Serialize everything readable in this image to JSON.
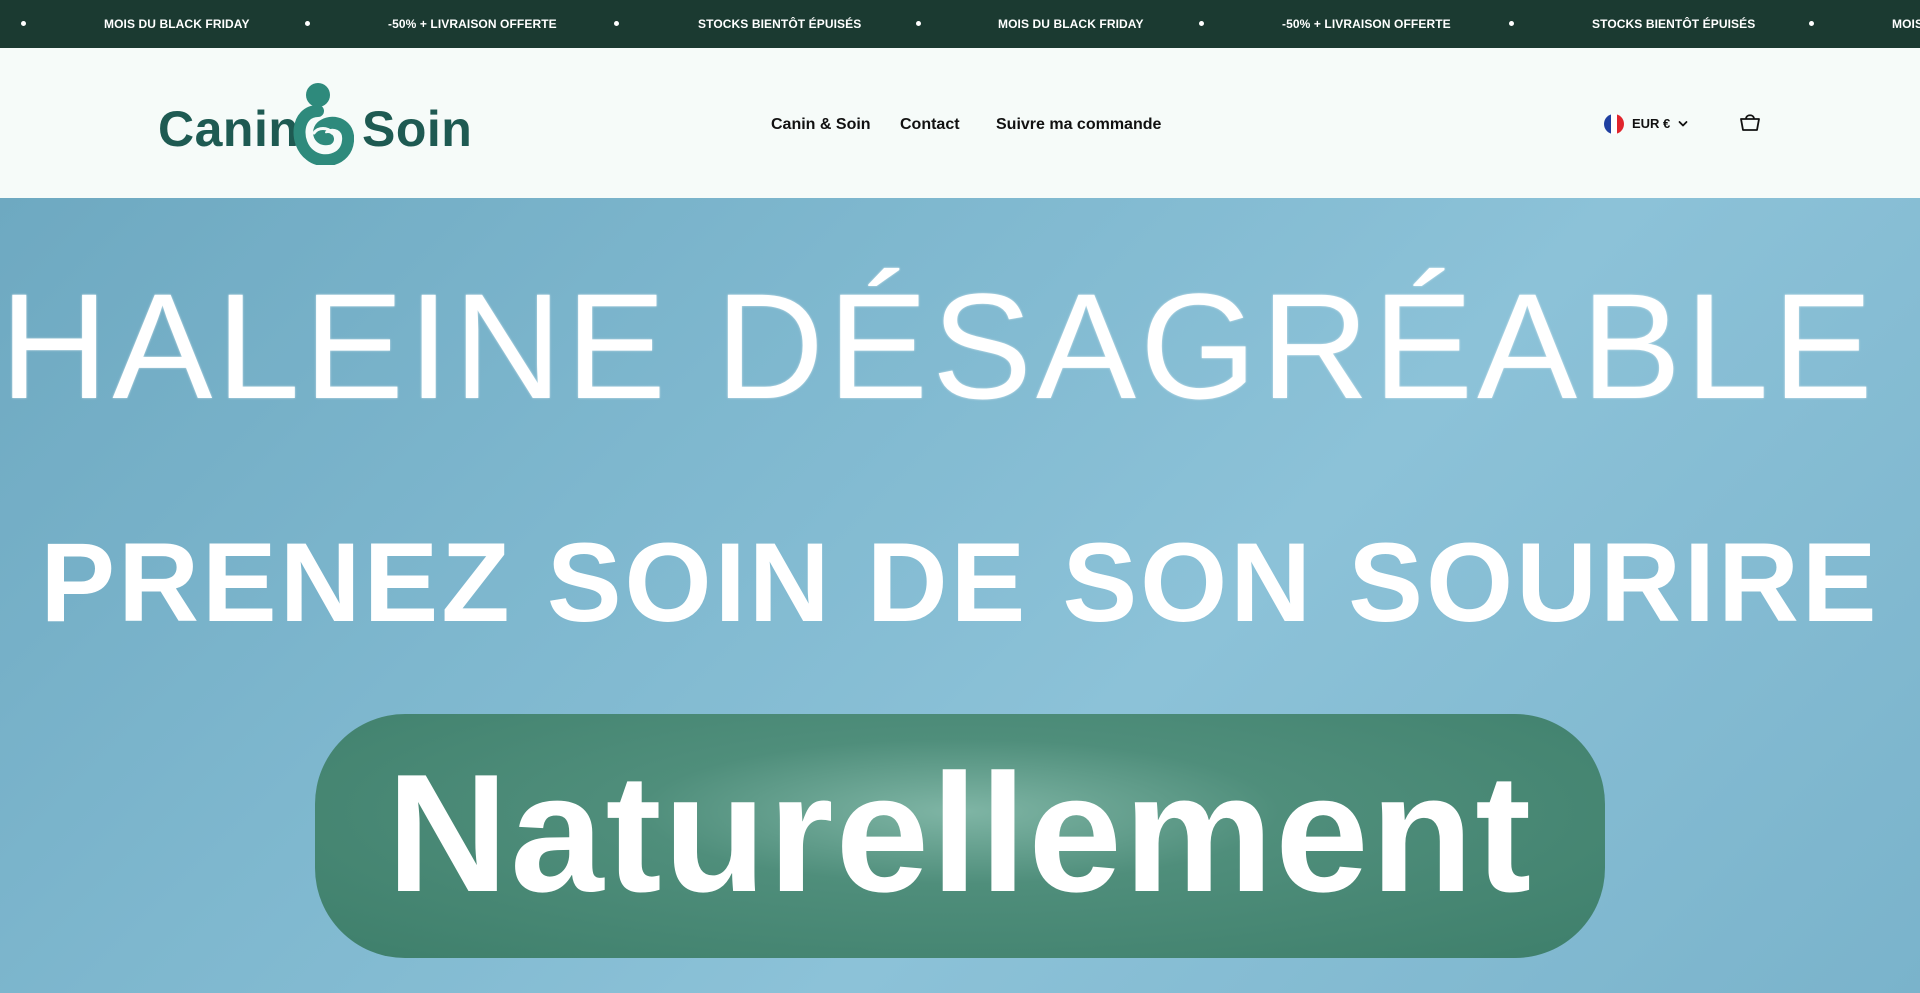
{
  "announcement": {
    "items": [
      "MOIS DU BLACK FRIDAY",
      "-50% + LIVRAISON OFFERTE",
      "STOCKS BIENTÔT ÉPUISÉS",
      "MOIS DU BLACK FRIDAY",
      "-50% + LIVRAISON OFFERTE",
      "STOCKS BIENTÔT ÉPUISÉS",
      "MOIS"
    ]
  },
  "header": {
    "logo_left": "Canin",
    "logo_right": "Soin",
    "logo_icon": "dog-heart-logo-icon",
    "nav": [
      "Canin & Soin",
      "Contact",
      "Suivre ma commande"
    ],
    "currency": "EUR €",
    "currency_flag": "france-flag-icon",
    "cart_icon": "basket-icon"
  },
  "hero": {
    "line1": "HALEINE DÉSAGRÉABLE ?",
    "line2": "PRENEZ SOIN DE SON SOURIRE",
    "line3": "Naturellement"
  },
  "colors": {
    "announcement_bg": "#1b3a31",
    "brand_green": "#1e5a52",
    "hero_bg": "#7fb8cf",
    "pill_green": "#4f8e7b"
  }
}
